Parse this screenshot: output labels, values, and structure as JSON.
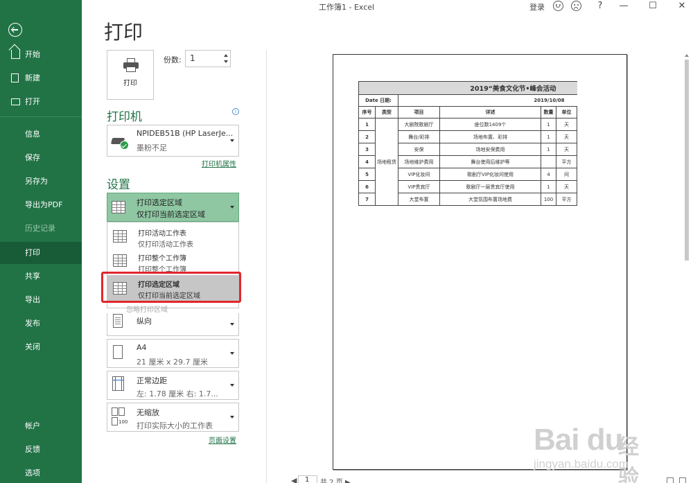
{
  "window": {
    "title": "工作簿1  -  Excel",
    "login": "登录",
    "help": "?",
    "minimize": "—",
    "maximize": "☐",
    "close": "✕"
  },
  "sidebar": {
    "items": [
      {
        "label": "开始"
      },
      {
        "label": "新建"
      },
      {
        "label": "打开"
      },
      {
        "label": "信息"
      },
      {
        "label": "保存"
      },
      {
        "label": "另存为"
      },
      {
        "label": "导出为PDF"
      },
      {
        "label": "历史记录"
      },
      {
        "label": "打印"
      },
      {
        "label": "共享"
      },
      {
        "label": "导出"
      },
      {
        "label": "发布"
      },
      {
        "label": "关闭"
      },
      {
        "label": "帐户"
      },
      {
        "label": "反馈"
      },
      {
        "label": "选项"
      }
    ]
  },
  "print": {
    "heading": "打印",
    "button_label": "打印",
    "copies_label": "份数:",
    "copies_value": "1",
    "printer_section": "打印机",
    "printer_name": "NPIDEB51B (HP LaserJe...",
    "printer_status": "墨粉不足",
    "printer_properties": "打印机属性",
    "settings_section": "设置",
    "scope_selected": {
      "title": "打印选定区域",
      "desc": "仅打印当前选定区域"
    },
    "scope_options": [
      {
        "title": "打印活动工作表",
        "desc": "仅打印活动工作表"
      },
      {
        "title": "打印整个工作簿",
        "desc": "打印整个工作簿"
      },
      {
        "title": "打印选定区域",
        "desc": "仅打印当前选定区域"
      }
    ],
    "ignore_print_area": "忽略打印区域",
    "orientation": "纵向",
    "paper": {
      "title": "A4",
      "desc": "21 厘米 x 29.7 厘米"
    },
    "margins": {
      "title": "正常边距",
      "desc": "左: 1.78 厘米    右: 1.7..."
    },
    "scaling": {
      "title": "无缩放",
      "desc": "打印实际大小的工作表"
    },
    "page_setup": "页面设置"
  },
  "preview": {
    "sheet_title": "2019“美食文化节•峰会活动",
    "date_label": "Date  日期:",
    "date_value": "2019/10/08",
    "headers": [
      "序号",
      "类型",
      "项目",
      "详述",
      "数量",
      "单位"
    ],
    "type_merged": "场地租赁",
    "rows": [
      {
        "no": "1",
        "item": "大剧院歌剧厅",
        "detail": "座位数1409个",
        "qty": "1",
        "unit": "天"
      },
      {
        "no": "2",
        "item": "舞台/彩排",
        "detail": "场地布置、彩排",
        "qty": "1",
        "unit": "天"
      },
      {
        "no": "3",
        "item": "安保",
        "detail": "场地安保费用",
        "qty": "1",
        "unit": "天"
      },
      {
        "no": "4",
        "item": "场地维护费用",
        "detail": "舞台使用后维护等",
        "qty": "",
        "unit": "平方"
      },
      {
        "no": "5",
        "item": "VIP化妆间",
        "detail": "歌剧厅VIP化妆间使用",
        "qty": "4",
        "unit": "间"
      },
      {
        "no": "6",
        "item": "VIP贵宾厅",
        "detail": "歌剧厅一层贵宾厅使用",
        "qty": "1",
        "unit": "天"
      },
      {
        "no": "7",
        "item": "大堂布置",
        "detail": "大堂氛围布置场地费",
        "qty": "100",
        "unit": "平方"
      }
    ],
    "pager_prefix": "◀",
    "page_num": "1",
    "pager_total": "共 2 页  ▶"
  },
  "watermark": {
    "brand": "Bai  du",
    "cn": "经验",
    "url": "jingyan.baidu.com"
  },
  "colors": {
    "accent": "#217346",
    "highlight": "#e0262b"
  }
}
